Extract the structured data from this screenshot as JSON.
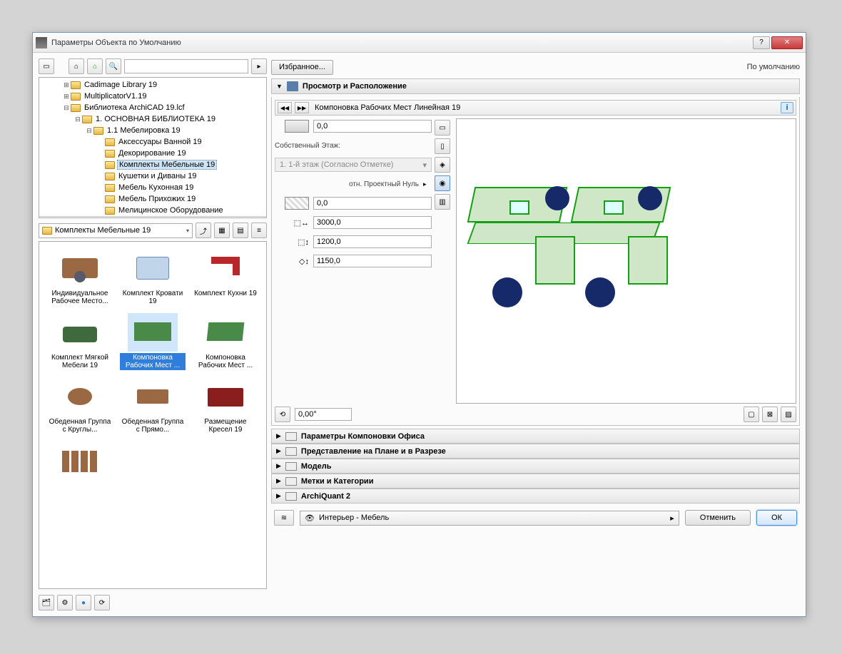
{
  "window": {
    "title": "Параметры Объекта по Умолчанию"
  },
  "favorites_button": "Избранное...",
  "default_label": "По умолчанию",
  "tree": {
    "items": [
      {
        "label": "Cadimage Library 19",
        "indent": 2,
        "expander": "+"
      },
      {
        "label": "MultiplicatorV1.19",
        "indent": 2,
        "expander": "+"
      },
      {
        "label": "Библиотека ArchiCAD 19.lcf",
        "indent": 2,
        "expander": "−"
      },
      {
        "label": "1. ОСНОВНАЯ БИБЛИОТЕКА 19",
        "indent": 3,
        "expander": "−"
      },
      {
        "label": "1.1 Мебелировка 19",
        "indent": 4,
        "expander": "−"
      },
      {
        "label": "Аксессуары Ванной 19",
        "indent": 5,
        "expander": ""
      },
      {
        "label": "Декорирование 19",
        "indent": 5,
        "expander": ""
      },
      {
        "label": "Комплекты Мебельные 19",
        "indent": 5,
        "expander": "",
        "selected": true
      },
      {
        "label": "Кушетки и Диваны 19",
        "indent": 5,
        "expander": ""
      },
      {
        "label": "Мебель Кухонная 19",
        "indent": 5,
        "expander": ""
      },
      {
        "label": "Мебель Прихожих 19",
        "indent": 5,
        "expander": ""
      },
      {
        "label": "Мелицинское Оборудование",
        "indent": 5,
        "expander": ""
      }
    ]
  },
  "folder_dropdown": "Комплекты Мебельные 19",
  "thumbnails": [
    {
      "label": "Индивидуальное Рабочее Место...",
      "glyph": "desk"
    },
    {
      "label": "Комплект Кровати 19",
      "glyph": "bed"
    },
    {
      "label": "Комплект Кухни 19",
      "glyph": "kitchen"
    },
    {
      "label": "Комплект Мягкой Мебели 19",
      "glyph": "sofa"
    },
    {
      "label": "Компоновка Рабочих Мест ...",
      "glyph": "ws",
      "selected": true
    },
    {
      "label": "Компоновка Рабочих Мест ...",
      "glyph": "ws2"
    },
    {
      "label": "Обеденная Группа с Круглы...",
      "glyph": "tround"
    },
    {
      "label": "Обеденная Группа с Прямо...",
      "glyph": "trect"
    },
    {
      "label": "Размещение Кресел 19",
      "glyph": "seats"
    },
    {
      "label": "",
      "glyph": "chairs"
    }
  ],
  "section_preview": "Просмотр и Расположение",
  "object": {
    "name": "Компоновка Рабочих Мест Линейная 19"
  },
  "params": {
    "elev": "0,0",
    "own_story_label": "Собственный Этаж:",
    "own_story_value": "1. 1-й этаж (Согласно Отметке)",
    "rel_label": "отн. Проектный Нуль",
    "bottom": "0,0",
    "dim_x": "3000,0",
    "dim_y": "1200,0",
    "dim_z": "1150,0",
    "angle": "0,00°"
  },
  "collapsed_sections": [
    "Параметры Компоновки Офиса",
    "Представление на Плане и в Разрезе",
    "Модель",
    "Метки и Категории",
    "ArchiQuant 2"
  ],
  "layer": "Интерьер - Мебель",
  "buttons": {
    "cancel": "Отменить",
    "ok": "ОК"
  }
}
